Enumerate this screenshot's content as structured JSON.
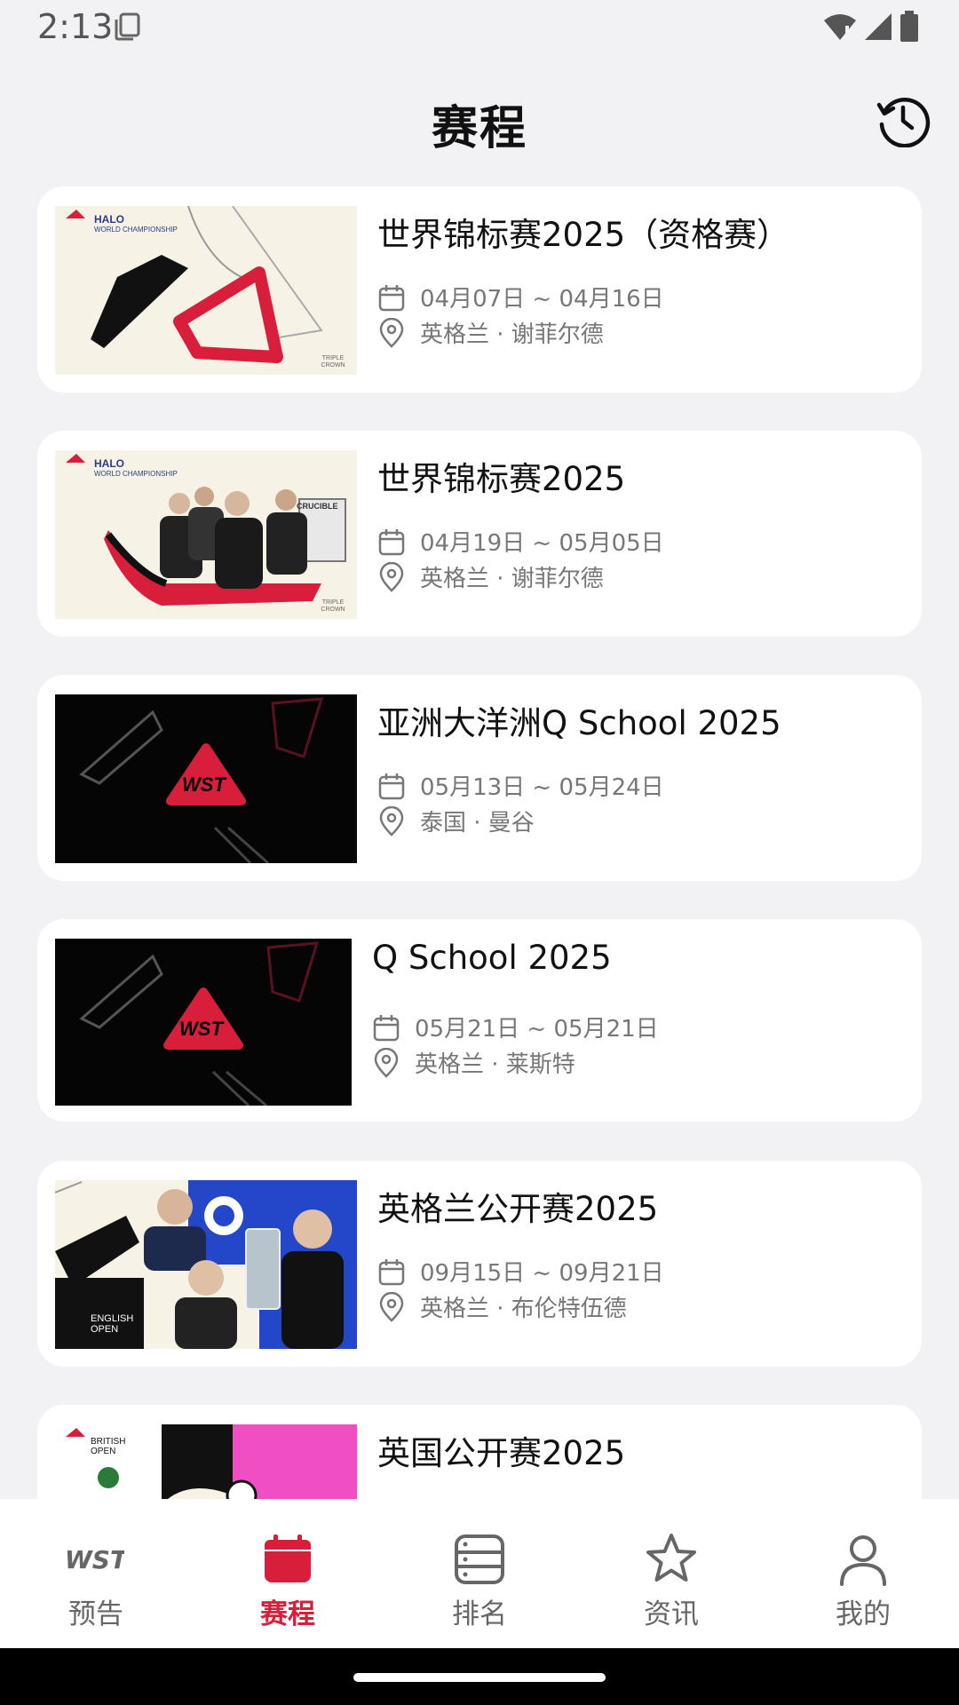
{
  "status": {
    "time": "2:13"
  },
  "header": {
    "title": "赛程"
  },
  "events": [
    {
      "title": "世界锦标赛2025（资格赛）",
      "dates": "04月07日 ~ 04月16日",
      "location": "英格兰 · 谢菲尔德",
      "thumb_text": "HALO",
      "thumb_sub": "WORLD CHAMPIONSHIP",
      "thumb_corner": "TRIPLE CROWN"
    },
    {
      "title": "世界锦标赛2025",
      "dates": "04月19日 ~ 05月05日",
      "location": "英格兰 · 谢菲尔德",
      "thumb_text": "HALO",
      "thumb_sub": "WORLD CHAMPIONSHIP",
      "thumb_corner": "TRIPLE CROWN",
      "thumb_sign": "CRUCIBLE"
    },
    {
      "title": "亚洲大洋洲Q School 2025",
      "dates": "05月13日 ~ 05月24日",
      "location": "泰国 · 曼谷",
      "thumb_logo": "WST"
    },
    {
      "title": "Q School 2025",
      "dates": "05月21日 ~ 05月21日",
      "location": "英格兰 · 莱斯特",
      "thumb_logo": "WST"
    },
    {
      "title": "英格兰公开赛2025",
      "dates": "09月15日 ~ 09月21日",
      "location": "英格兰 · 布伦特伍德",
      "thumb_text": "ENGLISH OPEN"
    },
    {
      "title": "英国公开赛2025",
      "thumb_text": "BRITISH OPEN"
    }
  ],
  "nav": {
    "items": [
      {
        "label": "预告",
        "icon": "wst-logo-icon"
      },
      {
        "label": "赛程",
        "icon": "calendar-icon",
        "active": true
      },
      {
        "label": "排名",
        "icon": "ranking-list-icon"
      },
      {
        "label": "资讯",
        "icon": "star-icon"
      },
      {
        "label": "我的",
        "icon": "person-icon"
      }
    ]
  },
  "colors": {
    "accent": "#d91e3c",
    "background": "#f2f2f4",
    "card": "#ffffff"
  }
}
